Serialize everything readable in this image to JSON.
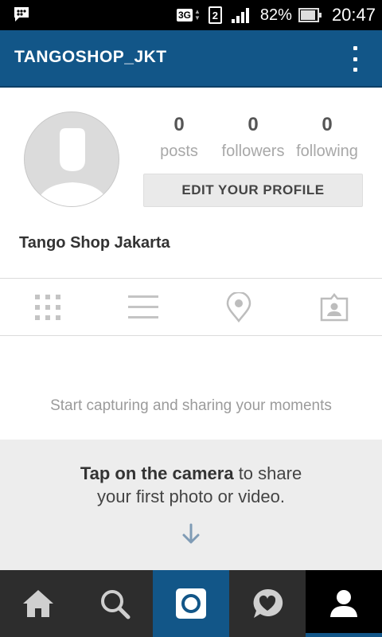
{
  "status_bar": {
    "network_type": "3G",
    "sim_slot": "2",
    "battery_percent": "82%",
    "battery_level": 0.82,
    "time": "20:47",
    "notification_icon": "bbm-chat-icon"
  },
  "header": {
    "title": "TANGOSHOP_JKT",
    "menu_icon": "overflow-menu-icon"
  },
  "profile": {
    "posts_count": "0",
    "posts_label": "posts",
    "followers_count": "0",
    "followers_label": "followers",
    "following_count": "0",
    "following_label": "following",
    "edit_button_label": "EDIT YOUR PROFILE",
    "display_name": "Tango Shop Jakarta"
  },
  "tabs": [
    {
      "name": "grid-view",
      "icon": "grid-icon"
    },
    {
      "name": "list-view",
      "icon": "list-icon"
    },
    {
      "name": "map-view",
      "icon": "location-pin-icon"
    },
    {
      "name": "tagged-view",
      "icon": "tagged-photo-icon"
    }
  ],
  "empty_state": {
    "message": "Start capturing and sharing your moments",
    "hint_bold": "Tap on the camera",
    "hint_rest_1": " to share",
    "hint_rest_2": "your first photo or video."
  },
  "bottom_nav": [
    {
      "name": "home",
      "icon": "home-icon"
    },
    {
      "name": "explore",
      "icon": "search-icon"
    },
    {
      "name": "camera",
      "icon": "camera-icon"
    },
    {
      "name": "activity",
      "icon": "heart-bubble-icon"
    },
    {
      "name": "profile",
      "icon": "profile-icon"
    }
  ],
  "colors": {
    "brand_blue": "#125688",
    "nav_background": "#2d2d2d"
  }
}
